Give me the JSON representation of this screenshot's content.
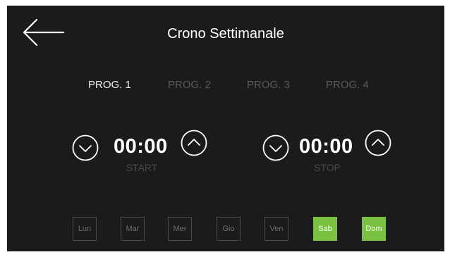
{
  "app": {
    "title": "Crono Settimanale"
  },
  "tabs": [
    {
      "label": "PROG. 1",
      "active": true
    },
    {
      "label": "PROG. 2",
      "active": false
    },
    {
      "label": "PROG. 3",
      "active": false
    },
    {
      "label": "PROG. 4",
      "active": false
    }
  ],
  "start": {
    "time": "00:00",
    "label": "START"
  },
  "stop": {
    "time": "00:00",
    "label": "STOP"
  },
  "days": [
    {
      "label": "Lun",
      "active": false
    },
    {
      "label": "Mar",
      "active": false
    },
    {
      "label": "Mer",
      "active": false
    },
    {
      "label": "Gio",
      "active": false
    },
    {
      "label": "Ven",
      "active": false
    },
    {
      "label": "Sab",
      "active": true
    },
    {
      "label": "Dom",
      "active": true
    }
  ],
  "colors": {
    "background": "#1b1b1b",
    "accent": "#7cc242",
    "inactive": "#5a5a5a",
    "text": "#ffffff"
  },
  "icons": {
    "back": "arrow-left-icon",
    "decrease": "chevron-down-icon",
    "increase": "chevron-up-icon"
  }
}
